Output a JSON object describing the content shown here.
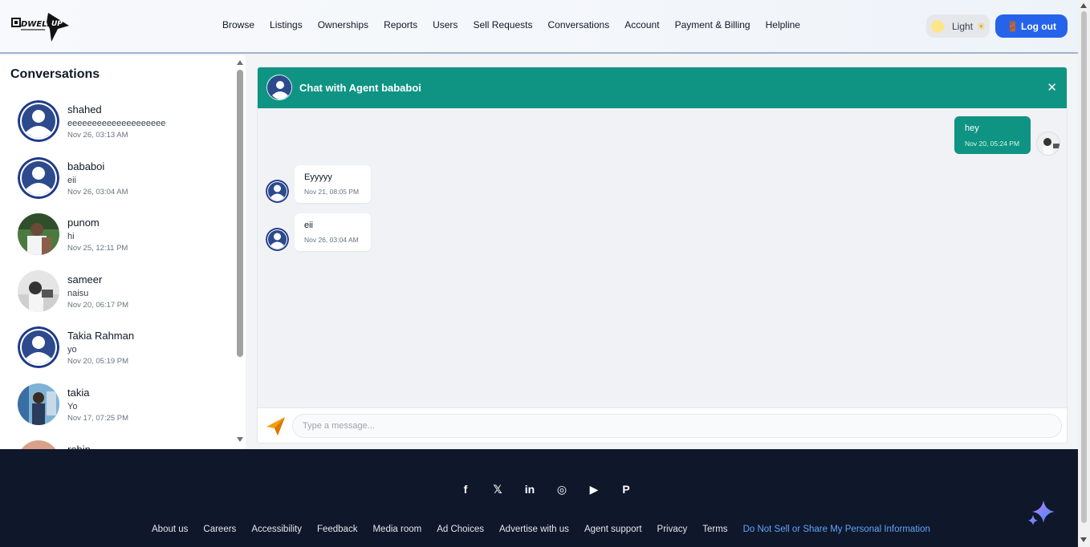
{
  "nav": {
    "items": [
      "Browse",
      "Listings",
      "Ownerships",
      "Reports",
      "Users",
      "Sell Requests",
      "Conversations",
      "Account",
      "Payment & Billing",
      "Helpline"
    ],
    "theme_label": "Light",
    "logout_label": "Log out"
  },
  "sidebar": {
    "title": "Conversations",
    "items": [
      {
        "name": "shahed",
        "message": "eeeeeeeeeeeeeeeeeeee",
        "time": "Nov 26, 03:13 AM"
      },
      {
        "name": "bababoi",
        "message": "eii",
        "time": "Nov 26, 03:04 AM"
      },
      {
        "name": "punom",
        "message": "hi",
        "time": "Nov 25, 12:11 PM"
      },
      {
        "name": "sameer",
        "message": "naisu",
        "time": "Nov 20, 06:17 PM"
      },
      {
        "name": "Takia Rahman",
        "message": "yo",
        "time": "Nov 20, 05:19 PM"
      },
      {
        "name": "takia",
        "message": "Yo",
        "time": "Nov 17, 07:25 PM"
      },
      {
        "name": "robin",
        "message": "",
        "time": ""
      }
    ]
  },
  "chat": {
    "title": "Chat with Agent bababoi",
    "messages": [
      {
        "text": "hey",
        "time": "Nov 20, 05:24 PM",
        "direction": "out"
      },
      {
        "text": "Eyyyyy",
        "time": "Nov 21, 08:05 PM",
        "direction": "in"
      },
      {
        "text": "eii",
        "time": "Nov 26, 03:04 AM",
        "direction": "in"
      }
    ],
    "input_placeholder": "Type a message..."
  },
  "footer": {
    "socials": [
      "facebook-icon",
      "x-icon",
      "linkedin-icon",
      "instagram-icon",
      "youtube-icon",
      "pinterest-icon"
    ],
    "links": [
      "About us",
      "Careers",
      "Accessibility",
      "Feedback",
      "Media room",
      "Ad Choices",
      "Advertise with us",
      "Agent support",
      "Privacy",
      "Terms",
      "Do Not Sell or Share My Personal Information"
    ]
  },
  "colors": {
    "accent": "#0f9484",
    "primary": "#2563eb",
    "footer_bg": "#0f172a",
    "avatar_blue": "#1e3a8a"
  }
}
